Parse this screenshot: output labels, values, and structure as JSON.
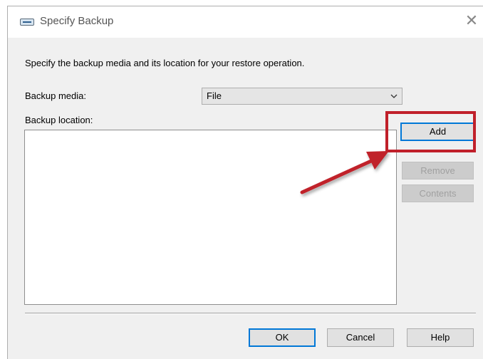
{
  "dialog": {
    "title": "Specify Backup",
    "close_glyph": "✕",
    "description": "Specify the backup media and its location for your restore operation."
  },
  "form": {
    "media_label": "Backup media:",
    "media_value": "File",
    "location_label": "Backup location:"
  },
  "side_buttons": {
    "add": "Add",
    "remove": "Remove",
    "contents": "Contents"
  },
  "footer": {
    "ok": "OK",
    "cancel": "Cancel",
    "help": "Help"
  },
  "icons": {
    "title": "backup-device-icon",
    "close": "close-icon",
    "dropdown": "chevron-down-icon"
  },
  "colors": {
    "annotation": "#c0202a",
    "focus": "#0078d7"
  }
}
